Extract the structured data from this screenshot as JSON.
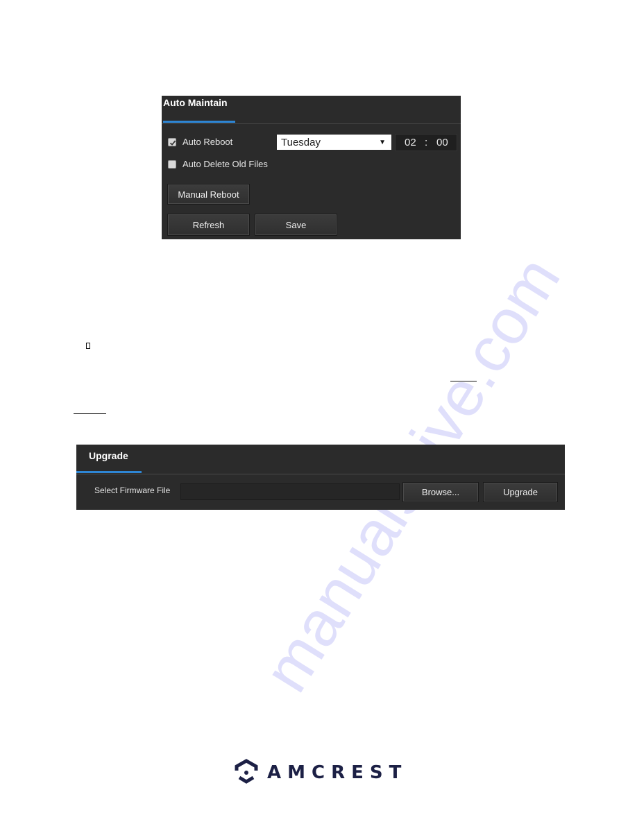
{
  "auto_maintain": {
    "title": "Auto Maintain",
    "auto_reboot": {
      "label": "Auto Reboot",
      "checked": true
    },
    "reboot_day": {
      "selected": "Tuesday"
    },
    "reboot_time": {
      "hour": "02",
      "separator": ":",
      "minute": "00"
    },
    "auto_delete": {
      "label": "Auto Delete Old Files",
      "checked": false
    },
    "manual_reboot_label": "Manual Reboot",
    "refresh_label": "Refresh",
    "save_label": "Save"
  },
  "upgrade": {
    "title": "Upgrade",
    "firmware_label": "Select Firmware File",
    "firmware_value": "",
    "browse_label": "Browse...",
    "upgrade_label": "Upgrade"
  },
  "watermark": {
    "text": "manualshive.com"
  },
  "footer": {
    "brand": "AMCREST"
  },
  "colors": {
    "accent": "#2e86d4",
    "panel_bg": "#2b2b2b",
    "brand": "#1c2045"
  }
}
